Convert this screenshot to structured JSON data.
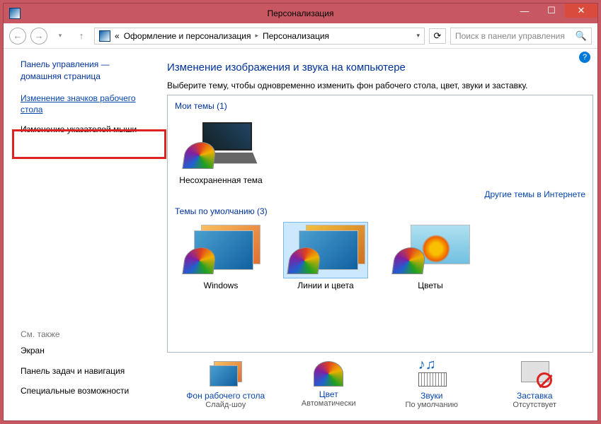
{
  "window": {
    "title": "Персонализация"
  },
  "toolbar": {
    "breadcrumb_prefix": "«",
    "breadcrumb1": "Оформление и персонализация",
    "breadcrumb2": "Персонализация",
    "search_placeholder": "Поиск в панели управления"
  },
  "sidebar": {
    "home_line1": "Панель управления —",
    "home_line2": "домашняя страница",
    "link_icons": "Изменение значков рабочего стола",
    "link_pointers": "Изменение указателей мыши",
    "seealso_head": "См. также",
    "seealso": [
      "Экран",
      "Панель задач и навигация",
      "Специальные возможности"
    ]
  },
  "content": {
    "title": "Изменение изображения и звука на компьютере",
    "subtitle": "Выберите тему, чтобы одновременно изменить фон рабочего стола, цвет, звуки и заставку.",
    "my_themes_head": "Мои темы (1)",
    "theme_unsaved": "Несохраненная тема",
    "online_link": "Другие темы в Интернете",
    "default_themes_head": "Темы по умолчанию (3)",
    "default_themes": [
      "Windows",
      "Линии и цвета",
      "Цветы"
    ]
  },
  "bottom": {
    "items": [
      {
        "label": "Фон рабочего стола",
        "sub": "Слайд-шоу"
      },
      {
        "label": "Цвет",
        "sub": "Автоматически"
      },
      {
        "label": "Звуки",
        "sub": "По умолчанию"
      },
      {
        "label": "Заставка",
        "sub": "Отсутствует"
      }
    ]
  }
}
